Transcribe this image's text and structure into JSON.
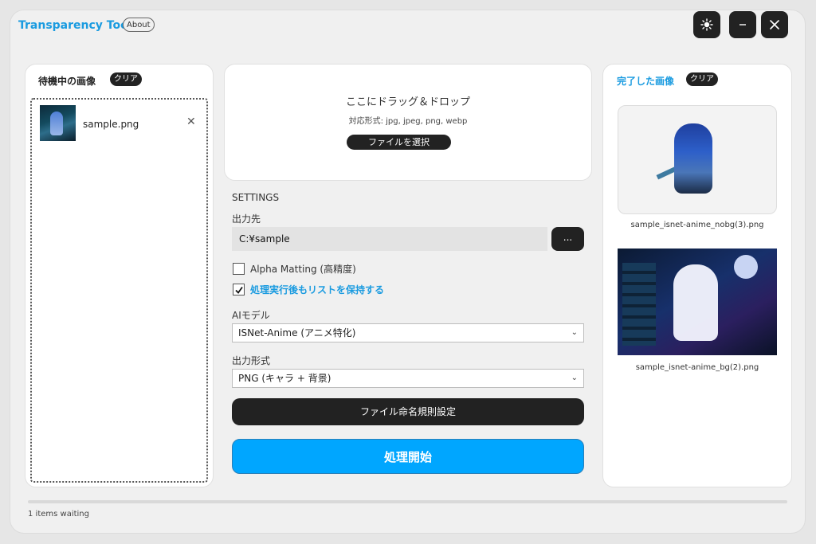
{
  "app": {
    "title": "Transparency Tool",
    "about_label": "About"
  },
  "window_controls": {
    "theme_icon": "sun-icon",
    "minimize_icon": "minimize-icon",
    "close_icon": "close-icon"
  },
  "queue": {
    "title": "待機中の画像",
    "clear_label": "クリア",
    "items": [
      {
        "name": "sample.png",
        "remove_icon": "close-icon"
      }
    ]
  },
  "dropzone": {
    "title": "ここにドラッグ＆ドロップ",
    "formats": "対応形式: jpg, jpeg, png, webp",
    "select_button": "ファイルを選択"
  },
  "settings": {
    "section_title": "SETTINGS",
    "output_label": "出力先",
    "output_value": "C:¥sample",
    "browse_label": "...",
    "alpha_matting": {
      "label": "Alpha Matting (高精度)",
      "checked": false
    },
    "keep_list": {
      "label": "処理実行後もリストを保持する",
      "checked": true
    },
    "model_label": "AIモデル",
    "model_value": "ISNet-Anime (アニメ特化)",
    "format_label": "出力形式",
    "format_value": "PNG (キャラ + 背景)",
    "naming_button": "ファイル命名規則設定",
    "start_button": "処理開始"
  },
  "completed": {
    "title": "完了した画像",
    "clear_label": "クリア",
    "items": [
      {
        "name": "sample_isnet-anime_nobg(3).png"
      },
      {
        "name": "sample_isnet-anime_bg(2).png"
      }
    ]
  },
  "status": {
    "text": "1 items waiting",
    "progress": 0
  },
  "colors": {
    "accent": "#00a6ff",
    "title": "#1a9be0",
    "dark": "#222222"
  }
}
